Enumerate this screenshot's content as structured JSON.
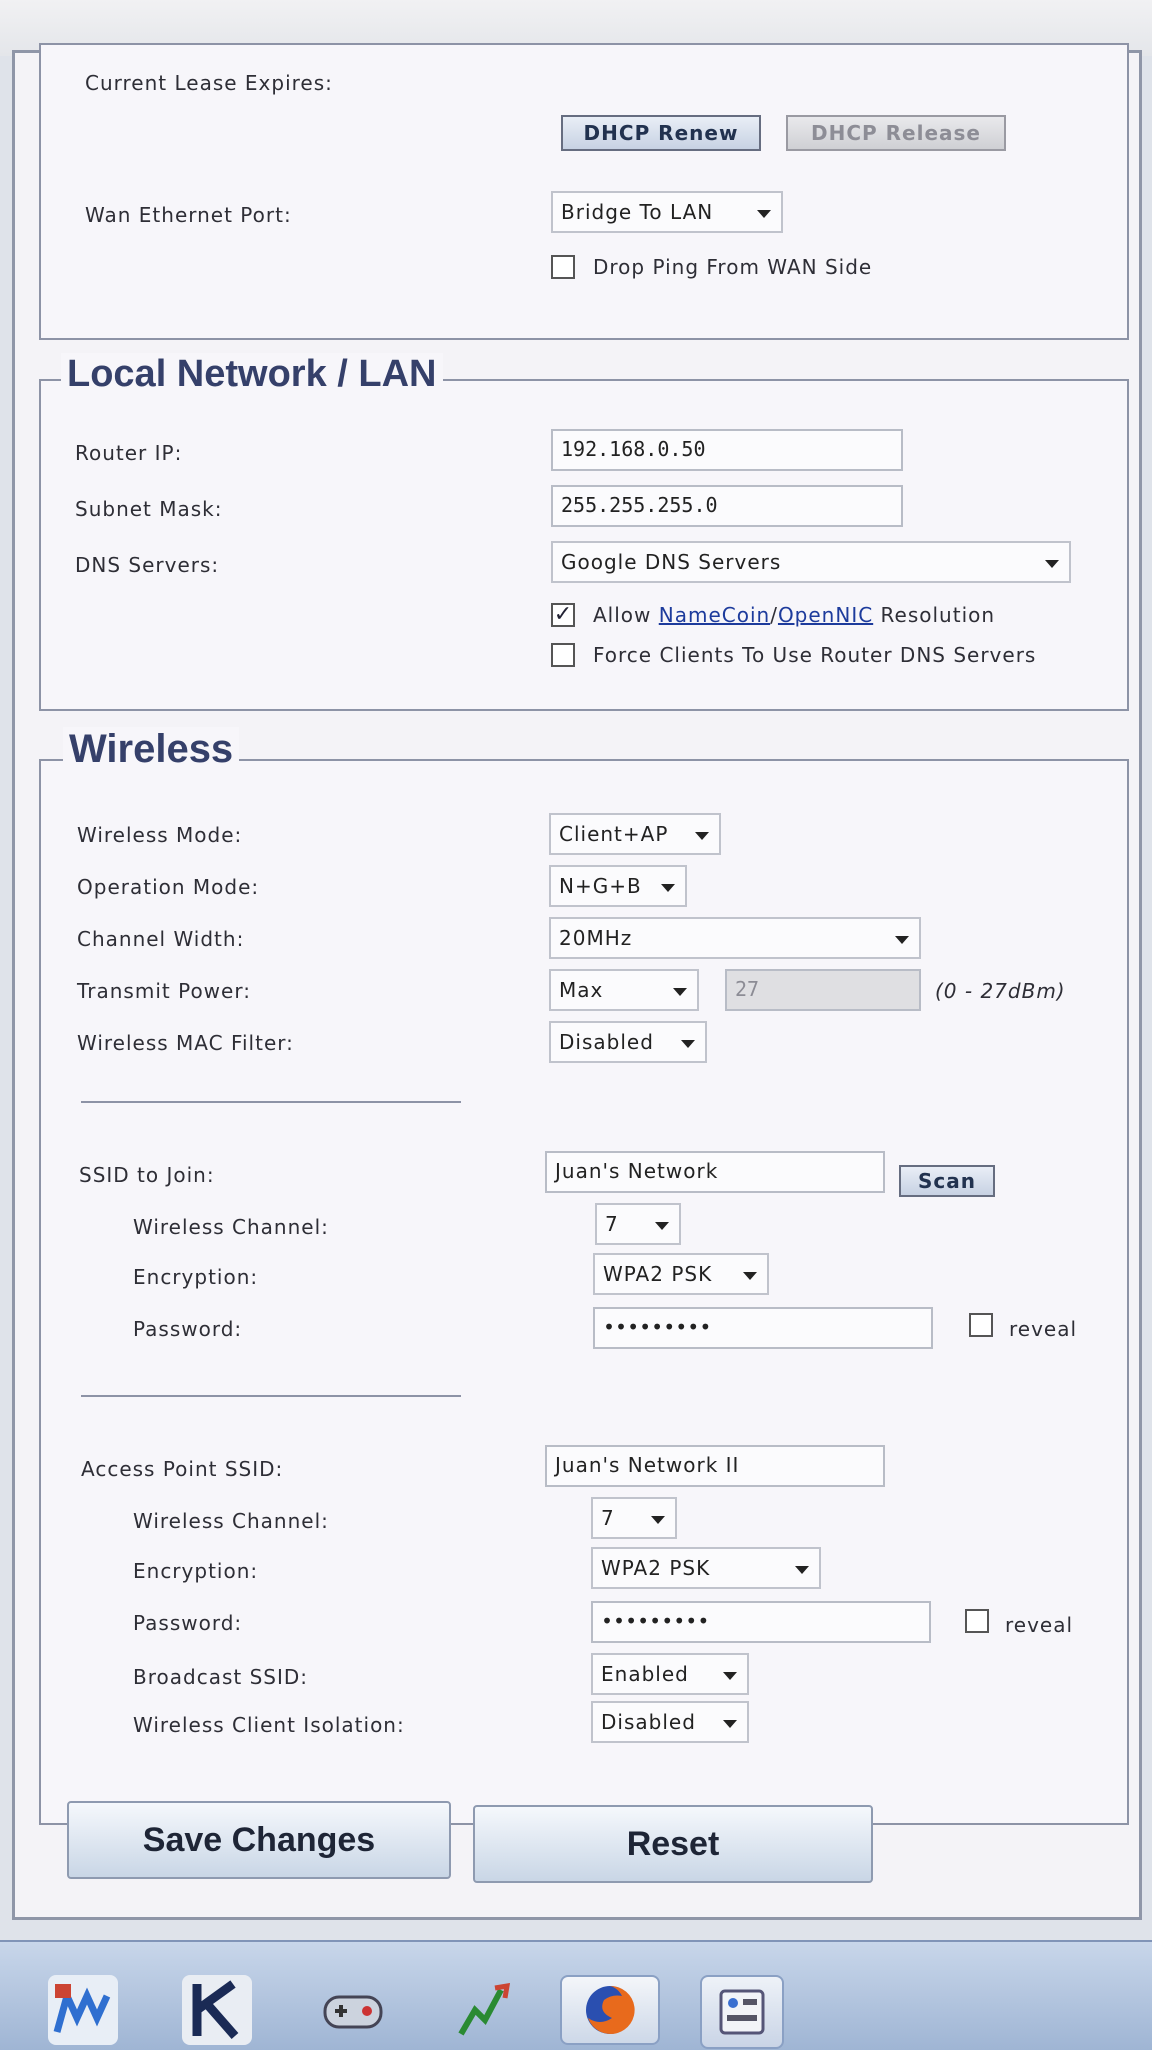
{
  "wan": {
    "lease_label": "Current Lease Expires:",
    "renew_button": "DHCP Renew",
    "release_button": "DHCP Release",
    "port_label": "Wan Ethernet Port:",
    "port_value": "Bridge To LAN",
    "drop_ping_label": "Drop Ping From WAN Side"
  },
  "lan": {
    "legend": "Local Network / LAN",
    "router_ip_label": "Router IP:",
    "router_ip": "192.168.0.50",
    "subnet_label": "Subnet Mask:",
    "subnet": "255.255.255.0",
    "dns_label": "DNS Servers:",
    "dns_value": "Google DNS Servers",
    "allow_prefix": "Allow ",
    "namecoin": "NameCoin",
    "slash": "/",
    "opennic": "OpenNIC",
    "allow_suffix": " Resolution",
    "force_label": "Force Clients To Use Router DNS Servers"
  },
  "wireless": {
    "legend": "Wireless",
    "mode_label": "Wireless Mode:",
    "mode_value": "Client+AP",
    "opmode_label": "Operation Mode:",
    "opmode_value": "N+G+B",
    "width_label": "Channel Width:",
    "width_value": "20MHz",
    "power_label": "Transmit Power:",
    "power_value": "Max",
    "power_number": "27",
    "power_range": "(0 - 27dBm)",
    "mac_label": "Wireless MAC Filter:",
    "mac_value": "Disabled",
    "client": {
      "ssid_label": "SSID to Join:",
      "ssid_value": "Juan's Network",
      "scan_button": "Scan",
      "channel_label": "Wireless Channel:",
      "channel_value": "7",
      "enc_label": "Encryption:",
      "enc_value": "WPA2 PSK",
      "pw_label": "Password:",
      "pw_value": "•••••••••",
      "reveal_label": "reveal"
    },
    "ap": {
      "ssid_label": "Access Point SSID:",
      "ssid_value": "Juan's Network II",
      "channel_label": "Wireless Channel:",
      "channel_value": "7",
      "enc_label": "Encryption:",
      "enc_value": "WPA2 PSK",
      "pw_label": "Password:",
      "pw_value": "•••••••••",
      "reveal_label": "reveal",
      "broadcast_label": "Broadcast SSID:",
      "broadcast_value": "Enabled",
      "isolation_label": "Wireless Client Isolation:",
      "isolation_value": "Disabled"
    }
  },
  "actions": {
    "save": "Save Changes",
    "reset": "Reset"
  },
  "taskbar": {
    "icons": [
      "app-wm-icon",
      "app-k-icon",
      "gamepad-icon",
      "chart-icon",
      "firefox-icon",
      "control-panel-icon"
    ]
  }
}
